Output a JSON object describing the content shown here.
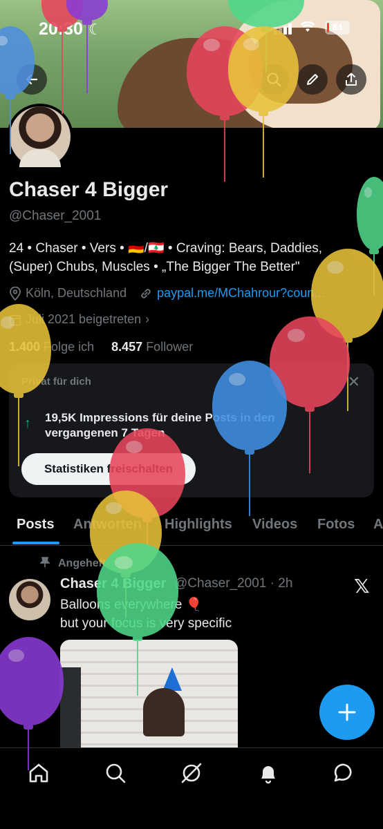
{
  "status_bar": {
    "time": "20:30",
    "battery": "84"
  },
  "profile": {
    "name": "Chaser 4 Bigger",
    "handle": "@Chaser_2001",
    "bio_line1": "24 • Chaser • Vers • 🇩🇪/🇱🇧 • Craving: Bears, Daddies,",
    "bio_line2": "(Super) Chubs, Muscles • „The Bigger The Better\"",
    "location": "Köln, Deutschland",
    "link": "paypal.me/MChahrour?coun...",
    "joined": "Juli 2021 beigetreten",
    "following_count": "1.400",
    "following_label": "Folge ich",
    "followers_count": "8.457",
    "followers_label": "Follower"
  },
  "private_card": {
    "label": "Privat für dich",
    "impressions": "19,5K Impressions für deine Posts in den vergangenen 7 Tagen",
    "button": "Statistiken freischalten"
  },
  "tabs": [
    "Posts",
    "Antworten",
    "Highlights",
    "Videos",
    "Fotos",
    "A"
  ],
  "post": {
    "pinned_label": "Angeheftet",
    "author": "Chaser 4 Bigger",
    "handle_time": "@Chaser_2001 · 2h",
    "line1": "Balloons everywhere 🎈",
    "line2": "but your focus is very specific"
  },
  "colors": {
    "accent": "#1d9bf0",
    "background": "#000000",
    "muted": "#71767b",
    "positive": "#00ba7c"
  },
  "icons": [
    "back-arrow-icon",
    "search-icon",
    "edit-pencil-icon",
    "share-icon",
    "location-icon",
    "link-icon",
    "calendar-icon",
    "chevron-right-icon",
    "close-icon",
    "trend-up-arrow-icon",
    "pin-icon",
    "x-logo-icon",
    "plus-icon",
    "home-icon",
    "grok-icon",
    "bell-icon",
    "messages-icon"
  ]
}
